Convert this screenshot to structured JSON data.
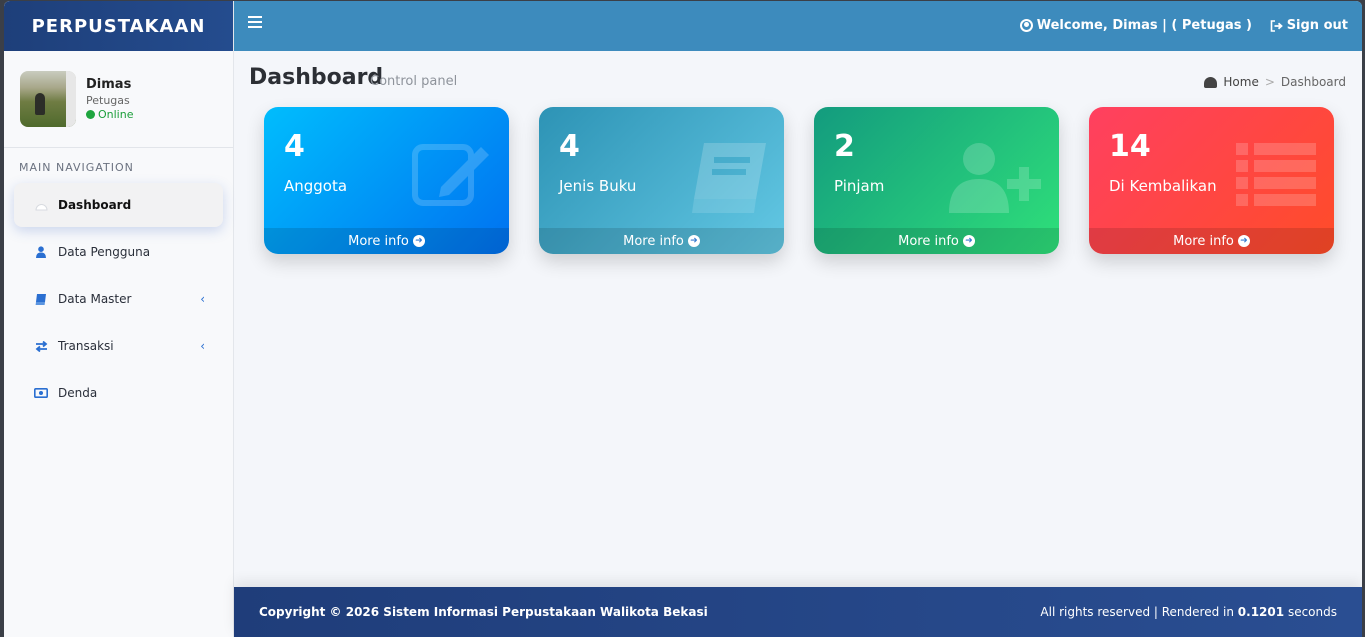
{
  "brand": "PERPUSTAKAAN",
  "user": {
    "name": "Dimas",
    "role": "Petugas",
    "status": "Online"
  },
  "nav": {
    "header": "MAIN NAVIGATION",
    "items": [
      {
        "label": "Dashboard",
        "icon": "dashboard-icon",
        "active": true
      },
      {
        "label": "Data Pengguna",
        "icon": "user-icon"
      },
      {
        "label": "Data Master",
        "icon": "book-icon",
        "expandable": true
      },
      {
        "label": "Transaksi",
        "icon": "exchange-icon",
        "expandable": true
      },
      {
        "label": "Denda",
        "icon": "money-icon"
      }
    ]
  },
  "topbar": {
    "welcome": "Welcome, Dimas | ( Petugas )",
    "signout": "Sign out"
  },
  "page": {
    "title": "Dashboard",
    "subtitle": "Control panel"
  },
  "breadcrumb": {
    "home": "Home",
    "sep": ">",
    "current": "Dashboard"
  },
  "cards": [
    {
      "value": "4",
      "label": "Anggota",
      "more": "More info",
      "icon": "edit-icon",
      "color": "#0071f0"
    },
    {
      "value": "4",
      "label": "Jenis Buku",
      "more": "More info",
      "icon": "book-icon",
      "color": "#2d93b5"
    },
    {
      "value": "2",
      "label": "Pinjam",
      "more": "More info",
      "icon": "user-plus-icon",
      "color": "#139b7e"
    },
    {
      "value": "14",
      "label": "Di Kembalikan",
      "more": "More info",
      "icon": "list-icon",
      "color": "#ff4060"
    }
  ],
  "footer": {
    "copyright": "Copyright © 2026 Sistem Informasi Perpustakaan Walikota Bekasi",
    "rights_prefix": "All rights reserved | Rendered in",
    "render_time": "0.1201",
    "rights_suffix": "seconds"
  }
}
